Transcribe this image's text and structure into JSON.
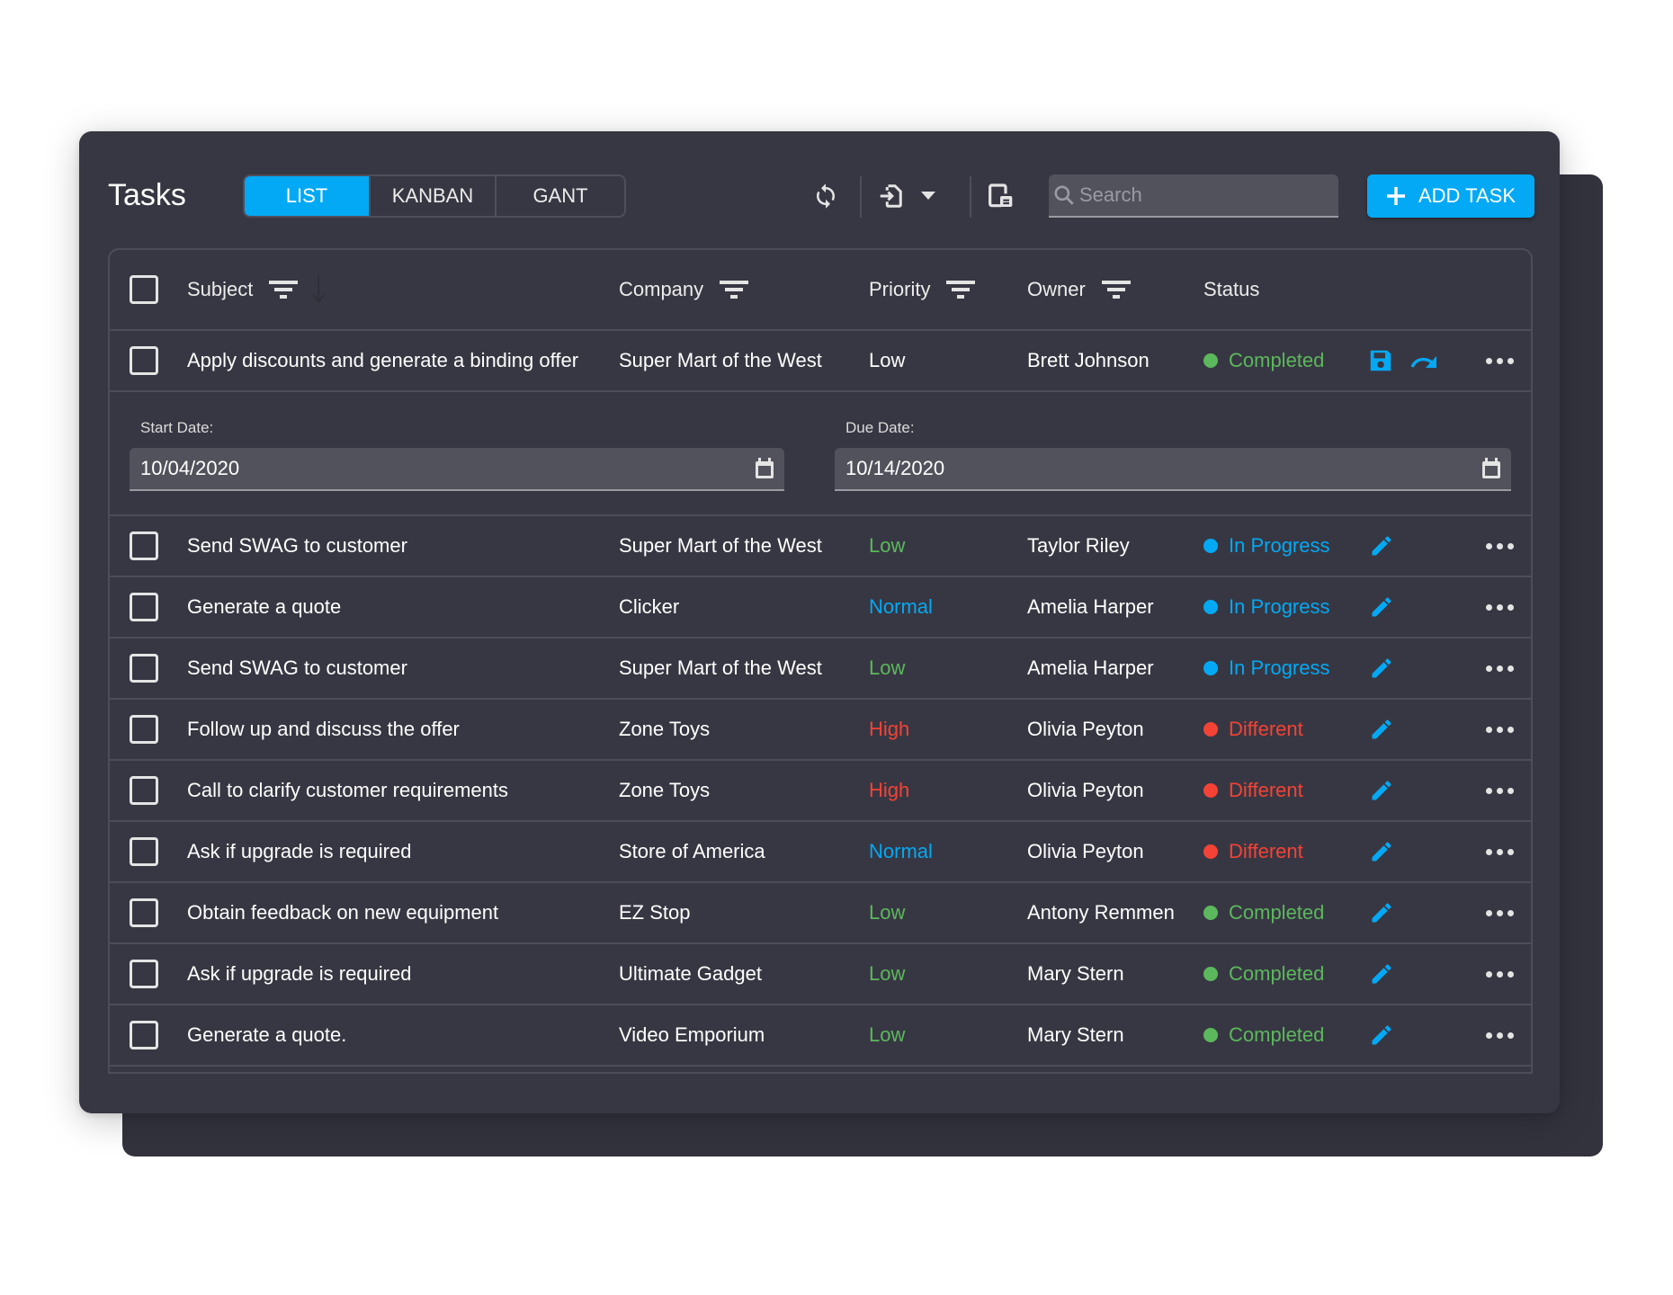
{
  "app": {
    "title": "Tasks"
  },
  "view_switcher": {
    "items": [
      {
        "label": "LIST",
        "active": true
      },
      {
        "label": "KANBAN",
        "active": false
      },
      {
        "label": "GANT",
        "active": false
      }
    ]
  },
  "toolbar": {
    "icons": [
      "refresh-icon",
      "export-icon",
      "dropdown-caret-icon",
      "column-chooser-icon"
    ],
    "search": {
      "placeholder": "Search",
      "value": ""
    },
    "add_task_label": "ADD TASK"
  },
  "colors": {
    "accent": "#03a9f4",
    "success": "#5cb85c",
    "danger": "#f44336",
    "card_bg": "#373743",
    "border": "#4d4d58"
  },
  "grid": {
    "columns": [
      {
        "label": "Subject",
        "filter": true
      },
      {
        "label": "Company",
        "filter": true
      },
      {
        "label": "Priority",
        "filter": true
      },
      {
        "label": "Owner",
        "filter": true
      },
      {
        "label": "Status",
        "filter": false
      }
    ],
    "editing_row": {
      "subject": "Apply discounts and generate a binding offer",
      "company": "Super Mart of the West",
      "priority": "Low",
      "owner": "Brett Johnson",
      "status": "Completed",
      "actions": [
        "save-icon",
        "redo-icon",
        "more-icon"
      ],
      "start_date_label": "Start Date:",
      "start_date": "10/04/2020",
      "due_date_label": "Due Date:",
      "due_date": "10/14/2020"
    },
    "rows": [
      {
        "subject": "Send SWAG to customer",
        "company": "Super Mart of the West",
        "priority": "Low",
        "owner": "Taylor Riley",
        "status": "In Progress"
      },
      {
        "subject": "Generate a quote",
        "company": "Clicker",
        "priority": "Normal",
        "owner": "Amelia Harper",
        "status": "In Progress"
      },
      {
        "subject": "Send SWAG to customer",
        "company": "Super Mart of the West",
        "priority": "Low",
        "owner": "Amelia Harper",
        "status": "In Progress"
      },
      {
        "subject": "Follow up and discuss the offer",
        "company": "Zone Toys",
        "priority": "High",
        "owner": "Olivia Peyton",
        "status": "Different"
      },
      {
        "subject": "Call to clarify customer requirements",
        "company": "Zone Toys",
        "priority": "High",
        "owner": "Olivia Peyton",
        "status": "Different"
      },
      {
        "subject": "Ask if upgrade is required",
        "company": "Store of America",
        "priority": "Normal",
        "owner": "Olivia Peyton",
        "status": "Different"
      },
      {
        "subject": "Obtain feedback on new equipment",
        "company": "EZ Stop",
        "priority": "Low",
        "owner": "Antony Remmen",
        "status": "Completed"
      },
      {
        "subject": "Ask if upgrade is required",
        "company": "Ultimate Gadget",
        "priority": "Low",
        "owner": "Mary Stern",
        "status": "Completed"
      },
      {
        "subject": "Generate a quote.",
        "company": "Video Emporium",
        "priority": "Low",
        "owner": "Mary Stern",
        "status": "Completed"
      }
    ]
  }
}
